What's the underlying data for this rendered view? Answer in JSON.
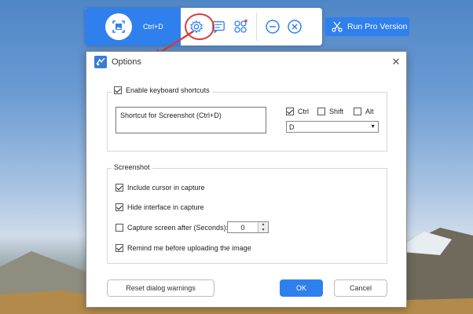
{
  "toolbar": {
    "shortcut": "Ctrl+D",
    "run_pro_label": "Run Pro Version"
  },
  "dialog": {
    "title": "Options",
    "keyboard": {
      "legend": "Enable keyboard shortcuts",
      "shortcut_text": "Shortcut for Screenshot (Ctrl+D)",
      "ctrl": "Ctrl",
      "shift": "Shift",
      "alt": "Alt",
      "key_value": "D"
    },
    "screenshot": {
      "legend": "Screenshot",
      "include_cursor": "Include cursor in capture",
      "hide_interface": "Hide interface in capture",
      "capture_after": "Capture screen after (Seconds):",
      "capture_after_value": "0",
      "remind": "Remind me before uploading the image"
    },
    "buttons": {
      "reset": "Reset dialog warnings",
      "ok": "OK",
      "cancel": "Cancel"
    }
  },
  "colors": {
    "accent": "#2f80ed",
    "highlight": "#d83b3b"
  },
  "icons": [
    "screenshot-icon",
    "gear-icon",
    "chat-icon",
    "butterfly-icon",
    "minimize-icon",
    "close-circle-icon",
    "scissors-icon",
    "app-icon",
    "close-icon"
  ]
}
